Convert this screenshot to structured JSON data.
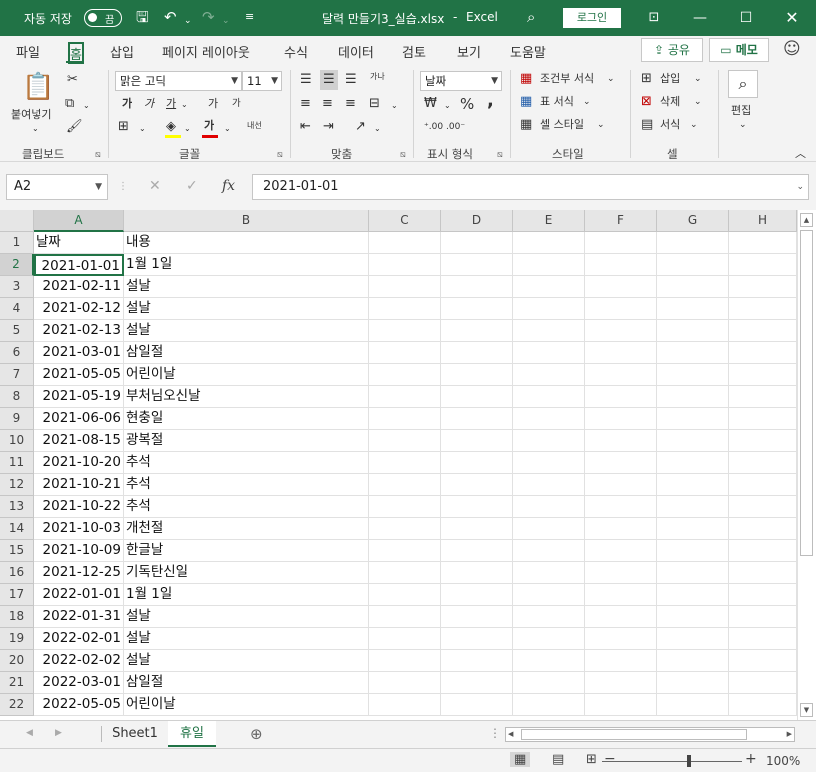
{
  "titlebar": {
    "autosave_label": "자동 저장",
    "autosave_state": "끔",
    "title": "달력 만들기3_실습.xlsx",
    "separator": "-",
    "app": "Excel",
    "login": "로그인"
  },
  "tabs": [
    "파일",
    "홈",
    "삽입",
    "페이지 레이아웃",
    "수식",
    "데이터",
    "검토",
    "보기",
    "도움말"
  ],
  "active_tab": "홈",
  "actions": {
    "share": "공유",
    "memo": "메모"
  },
  "ribbon": {
    "clipboard": {
      "paste": "붙여넣기",
      "group": "클립보드"
    },
    "font": {
      "name": "맑은 고딕",
      "size": "11",
      "bold": "가",
      "italic": "가",
      "underline": "가",
      "grow": "가",
      "shrink": "가",
      "phonetic": "내선",
      "font_color_glyph": "가",
      "group": "글꼴"
    },
    "alignment": {
      "wrap": "가나",
      "group": "맞춤"
    },
    "number": {
      "format": "날짜",
      "percent": "%",
      "comma": ",",
      "group": "표시 형식"
    },
    "styles": {
      "conditional": "조건부 서식",
      "table": "표 서식",
      "cell": "셀 스타일",
      "group": "스타일"
    },
    "cells": {
      "insert": "삽입",
      "delete": "삭제",
      "format": "서식",
      "group": "셀"
    },
    "editing": {
      "label": "편집"
    }
  },
  "formula_bar": {
    "name_box": "A2",
    "fx": "fx",
    "value": "2021-01-01"
  },
  "columns": [
    "A",
    "B",
    "C",
    "D",
    "E",
    "F",
    "G",
    "H"
  ],
  "rows": [
    {
      "n": "1",
      "a": "날짜",
      "b": "내용"
    },
    {
      "n": "2",
      "a": "2021-01-01",
      "b": "1월 1일"
    },
    {
      "n": "3",
      "a": "2021-02-11",
      "b": "설날"
    },
    {
      "n": "4",
      "a": "2021-02-12",
      "b": "설날"
    },
    {
      "n": "5",
      "a": "2021-02-13",
      "b": "설날"
    },
    {
      "n": "6",
      "a": "2021-03-01",
      "b": "삼일절"
    },
    {
      "n": "7",
      "a": "2021-05-05",
      "b": "어린이날"
    },
    {
      "n": "8",
      "a": "2021-05-19",
      "b": "부처님오신날"
    },
    {
      "n": "9",
      "a": "2021-06-06",
      "b": "현충일"
    },
    {
      "n": "10",
      "a": "2021-08-15",
      "b": "광복절"
    },
    {
      "n": "11",
      "a": "2021-10-20",
      "b": "추석"
    },
    {
      "n": "12",
      "a": "2021-10-21",
      "b": "추석"
    },
    {
      "n": "13",
      "a": "2021-10-22",
      "b": "추석"
    },
    {
      "n": "14",
      "a": "2021-10-03",
      "b": "개천절"
    },
    {
      "n": "15",
      "a": "2021-10-09",
      "b": "한글날"
    },
    {
      "n": "16",
      "a": "2021-12-25",
      "b": "기독탄신일"
    },
    {
      "n": "17",
      "a": "2022-01-01",
      "b": "1월 1일"
    },
    {
      "n": "18",
      "a": "2022-01-31",
      "b": "설날"
    },
    {
      "n": "19",
      "a": "2022-02-01",
      "b": "설날"
    },
    {
      "n": "20",
      "a": "2022-02-02",
      "b": "설날"
    },
    {
      "n": "21",
      "a": "2022-03-01",
      "b": "삼일절"
    },
    {
      "n": "22",
      "a": "2022-05-05",
      "b": "어린이날"
    }
  ],
  "active_cell": "A2",
  "sheets": [
    "Sheet1",
    "휴일"
  ],
  "active_sheet": "휴일",
  "status": {
    "zoom": "100%"
  },
  "colors": {
    "accent": "#217346",
    "ribbon_bg": "#f3f3f3",
    "font_color_bar": "#e00000",
    "fill_color_bar": "#ffff00"
  }
}
